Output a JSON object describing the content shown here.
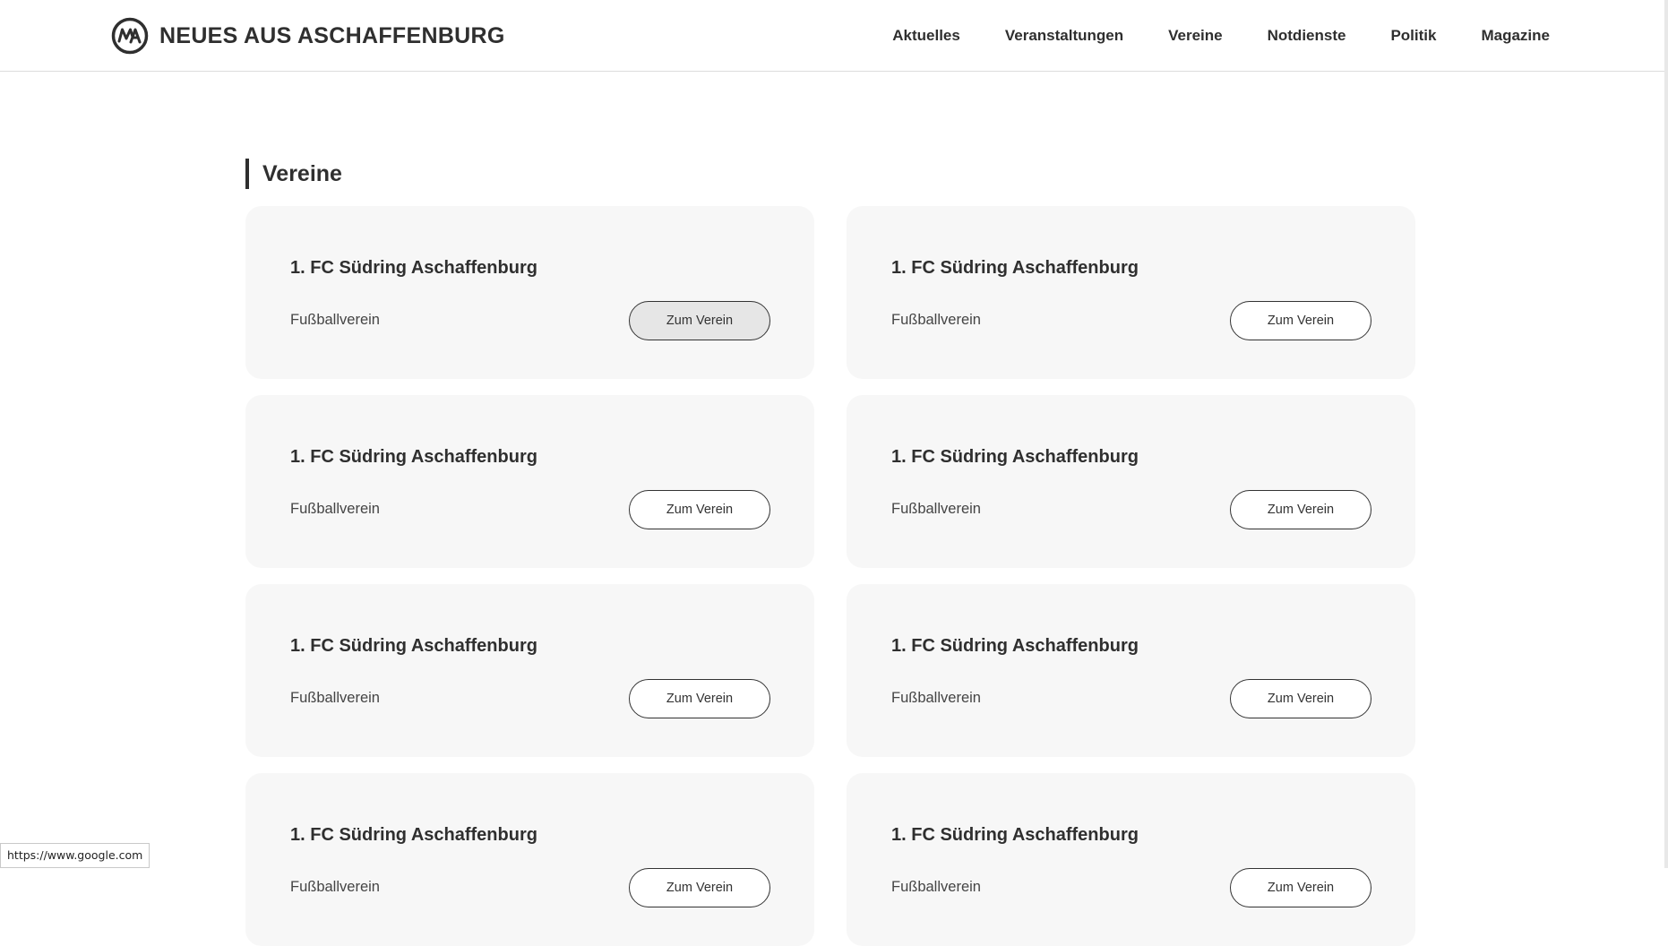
{
  "header": {
    "logo_text": "NEUES AUS ASCHAFFENBURG",
    "nav": [
      {
        "label": "Aktuelles"
      },
      {
        "label": "Veranstaltungen"
      },
      {
        "label": "Vereine"
      },
      {
        "label": "Notdienste"
      },
      {
        "label": "Politik"
      },
      {
        "label": "Magazine"
      }
    ]
  },
  "main": {
    "section_title": "Vereine",
    "cards": [
      {
        "title": "1. FC Südring Aschaffenburg",
        "type": "Fußballverein",
        "button": "Zum Verein",
        "hovered": true
      },
      {
        "title": "1. FC Südring Aschaffenburg",
        "type": "Fußballverein",
        "button": "Zum Verein"
      },
      {
        "title": "1. FC Südring Aschaffenburg",
        "type": "Fußballverein",
        "button": "Zum Verein"
      },
      {
        "title": "1. FC Südring Aschaffenburg",
        "type": "Fußballverein",
        "button": "Zum Verein"
      },
      {
        "title": "1. FC Südring Aschaffenburg",
        "type": "Fußballverein",
        "button": "Zum Verein"
      },
      {
        "title": "1. FC Südring Aschaffenburg",
        "type": "Fußballverein",
        "button": "Zum Verein"
      },
      {
        "title": "1. FC Südring Aschaffenburg",
        "type": "Fußballverein",
        "button": "Zum Verein"
      },
      {
        "title": "1. FC Südring Aschaffenburg",
        "type": "Fußballverein",
        "button": "Zum Verein"
      }
    ]
  },
  "status_bar": {
    "url": "https://www.google.com"
  },
  "colors": {
    "text": "#2f2f2f",
    "card_bg": "#f7f7f7",
    "button_border": "#333333",
    "button_hover_bg": "#e6e6e6"
  }
}
